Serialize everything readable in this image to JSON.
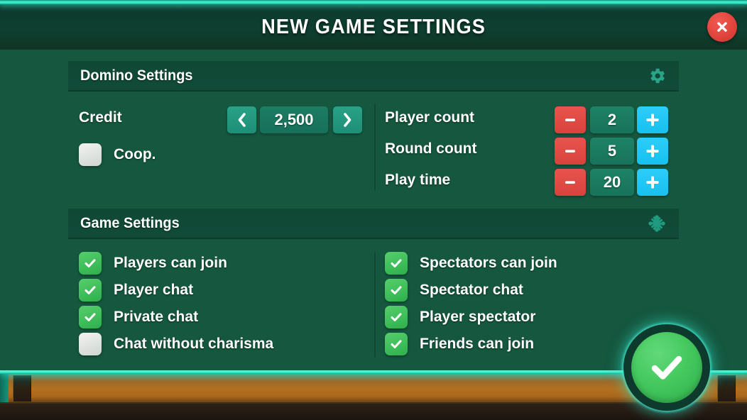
{
  "window": {
    "title": "NEW GAME SETTINGS",
    "close_icon": "close-x-icon"
  },
  "colors": {
    "background": "#15573f",
    "titlebar": "#0e3f30",
    "neon_accent": "#3ff0cf",
    "section_band": "#0f4936",
    "minus_red": "#e0453d",
    "plus_cyan": "#17c0ef",
    "value_green": "#1d8266",
    "chevron_green": "#1f8e76",
    "checkbox_on": "#3dbd58",
    "checkbox_off": "#e4e8e5",
    "confirm_green": "#45c95f",
    "close_red": "#e0453d",
    "footer_wood": "#b4701f"
  },
  "domino_section": {
    "title": "Domino Settings",
    "icon": "gear-icon",
    "credit": {
      "label": "Credit",
      "value": "2,500",
      "prev_icon": "chevron-left-icon",
      "next_icon": "chevron-right-icon"
    },
    "coop": {
      "label": "Coop.",
      "checked": false
    },
    "steppers": [
      {
        "label": "Player count",
        "value": "2",
        "minus_icon": "minus-icon",
        "plus_icon": "plus-icon"
      },
      {
        "label": "Round count",
        "value": "5",
        "minus_icon": "minus-icon",
        "plus_icon": "plus-icon"
      },
      {
        "label": "Play time",
        "value": "20",
        "minus_icon": "minus-icon",
        "plus_icon": "plus-icon"
      }
    ]
  },
  "game_section": {
    "title": "Game Settings",
    "icon": "puzzle-icon",
    "left_options": [
      {
        "label": "Players can join",
        "checked": true
      },
      {
        "label": "Player chat",
        "checked": true
      },
      {
        "label": "Private chat",
        "checked": true
      },
      {
        "label": "Chat without charisma",
        "checked": false
      }
    ],
    "right_options": [
      {
        "label": "Spectators can join",
        "checked": true
      },
      {
        "label": "Spectator chat",
        "checked": true
      },
      {
        "label": "Player spectator",
        "checked": true
      },
      {
        "label": "Friends can join",
        "checked": true
      }
    ]
  },
  "confirm_button": {
    "icon": "check-icon",
    "label": ""
  }
}
